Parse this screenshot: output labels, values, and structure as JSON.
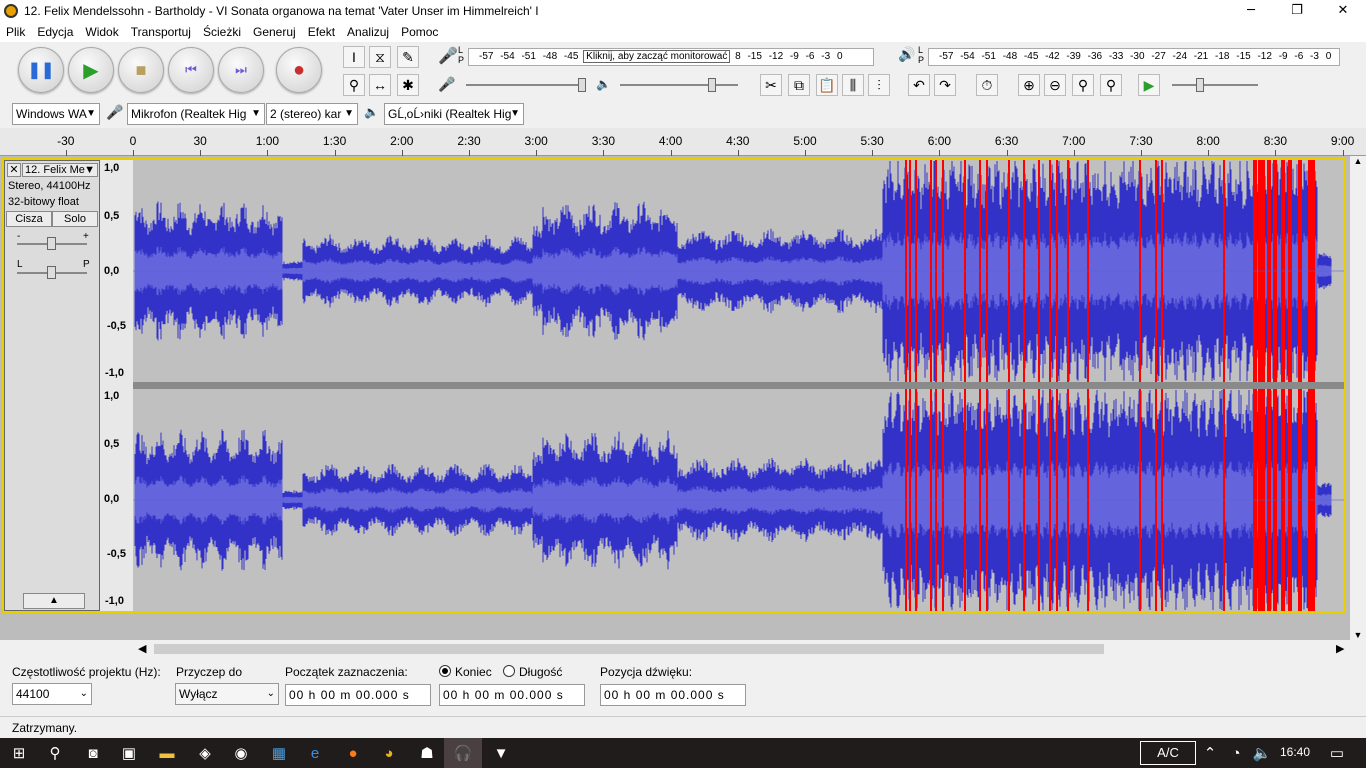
{
  "window": {
    "title": "12. Felix Mendelssohn - Bartholdy - VI Sonata organowa na temat 'Vater Unser im Himmelreich' I"
  },
  "menu": [
    "Plik",
    "Edycja",
    "Widok",
    "Transportuj",
    "Ścieżki",
    "Generuj",
    "Efekt",
    "Analizuj",
    "Pomoc"
  ],
  "meters": {
    "rec_scale": "-57 -54 -51 -48 -45",
    "rec_hint": "Kliknij, aby zacząć monitorować",
    "rec_scale2": "8 -15 -12 -9 -6 -3 0",
    "play_scale": "-57 -54 -51 -48 -45 -42 -39 -36 -33 -30 -27 -24 -21 -18 -15 -12 -9 -6 -3 0",
    "lp_label": "L\nP"
  },
  "devices": {
    "host": "Windows WA",
    "mic": "Mikrofon (Realtek Hig",
    "channels": "2 (stereo) kar",
    "speakers": "GĹ‚oĹ›niki (Realtek Hig"
  },
  "ruler": [
    "-30",
    "0",
    "30",
    "1:00",
    "1:30",
    "2:00",
    "2:30",
    "3:00",
    "3:30",
    "4:00",
    "4:30",
    "5:00",
    "5:30",
    "6:00",
    "6:30",
    "7:00",
    "7:30",
    "8:00",
    "8:30",
    "9:00"
  ],
  "track": {
    "name": "12. Felix Me",
    "info1": "Stereo, 44100Hz",
    "info2": "32-bitowy float",
    "mute": "Cisza",
    "solo": "Solo",
    "gain_minus": "-",
    "gain_plus": "+",
    "pan_l": "L",
    "pan_r": "P"
  },
  "vscale": [
    "1,0",
    "0,5",
    "0,0",
    "-0,5",
    "-1,0"
  ],
  "selection_bar": {
    "rate_label": "Częstotliwość projektu (Hz):",
    "rate_value": "44100",
    "snap_label": "Przyczep do",
    "snap_value": "Wyłącz",
    "start_label": "Początek zaznaczenia:",
    "end_radio": "Koniec",
    "length_radio": "Długość",
    "start_value": "00 h 00 m 00.000 s",
    "end_value": "00 h 00 m 00.000 s",
    "pos_label": "Pozycja dźwięku:",
    "pos_value": "00 h 00 m 00.000 s"
  },
  "status": "Zatrzymany.",
  "taskbar": {
    "lang": "A/C",
    "time": "16:40"
  },
  "colors": {
    "wave": "#3232c8",
    "wave_rms": "#6464dc",
    "clip": "#ff0000",
    "track_bg": "#c0c0c0"
  }
}
